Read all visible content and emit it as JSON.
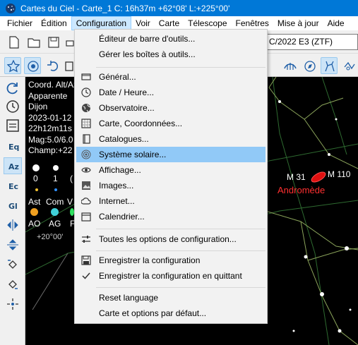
{
  "window": {
    "title": "Cartes du Ciel - Carte_1  C: 16h37m +62°08' L:+225°00'"
  },
  "menubar": [
    {
      "label": "Fichier"
    },
    {
      "label": "Édition"
    },
    {
      "label": "Configuration"
    },
    {
      "label": "Voir"
    },
    {
      "label": "Carte"
    },
    {
      "label": "Télescope"
    },
    {
      "label": "Fenêtres"
    },
    {
      "label": "Mise à jour"
    },
    {
      "label": "Aide"
    }
  ],
  "toolbar": {
    "object_field": "C/2022 E3 (ZTF)"
  },
  "configuration_menu": {
    "items": [
      {
        "label": "Éditeur de barre d'outils...",
        "icon": "none"
      },
      {
        "label": "Gérer les boîtes à outils...",
        "icon": "none"
      },
      {
        "label": "Général...",
        "icon": "window-icon"
      },
      {
        "label": "Date / Heure...",
        "icon": "clock-icon"
      },
      {
        "label": "Observatoire...",
        "icon": "globe-icon"
      },
      {
        "label": "Carte, Coordonnées...",
        "icon": "grid-icon"
      },
      {
        "label": "Catalogues...",
        "icon": "book-icon"
      },
      {
        "label": "Système solaire...",
        "icon": "solar-system-icon"
      },
      {
        "label": "Affichage...",
        "icon": "eye-icon"
      },
      {
        "label": "Images...",
        "icon": "image-icon"
      },
      {
        "label": "Internet...",
        "icon": "cloud-icon"
      },
      {
        "label": "Calendrier...",
        "icon": "calendar-icon"
      },
      {
        "label": "Toutes les options de configuration...",
        "icon": "sliders-icon"
      },
      {
        "label": "Enregistrer la configuration",
        "icon": "save-icon"
      },
      {
        "label": "Enregistrer la configuration en quittant",
        "icon": "check-icon"
      },
      {
        "label": "Reset language",
        "icon": "none"
      },
      {
        "label": "Carte et options par défaut...",
        "icon": "none"
      }
    ],
    "highlighted": "Système solaire..."
  },
  "left_toolbar": [
    {
      "label": "Eq"
    },
    {
      "label": "Az"
    },
    {
      "label": "Ec"
    },
    {
      "label": "Gl"
    }
  ],
  "chart_info": {
    "lines": [
      "Coord. Alt/Az",
      "Apparente",
      "Dijon",
      "2023-01-12",
      "22h12m11s",
      "Mag:5.0/6.0",
      "Champ:+22"
    ],
    "legend_numbers": [
      "0",
      "1",
      "("
    ],
    "legend_labels_1": [
      "Ast",
      "Com",
      "V"
    ],
    "legend_labels_2": [
      "AO",
      "AG",
      "F"
    ],
    "grid_label": "+20°00'",
    "colors": {
      "asteroid": "#f0a020",
      "comet": "#40d0d8",
      "variable": "#30e060"
    }
  },
  "sky_objects": {
    "galaxy_1": "M 31",
    "galaxy_2": "M 110",
    "constellation": "Andromède",
    "constellation_color": "#ff2a2a"
  }
}
